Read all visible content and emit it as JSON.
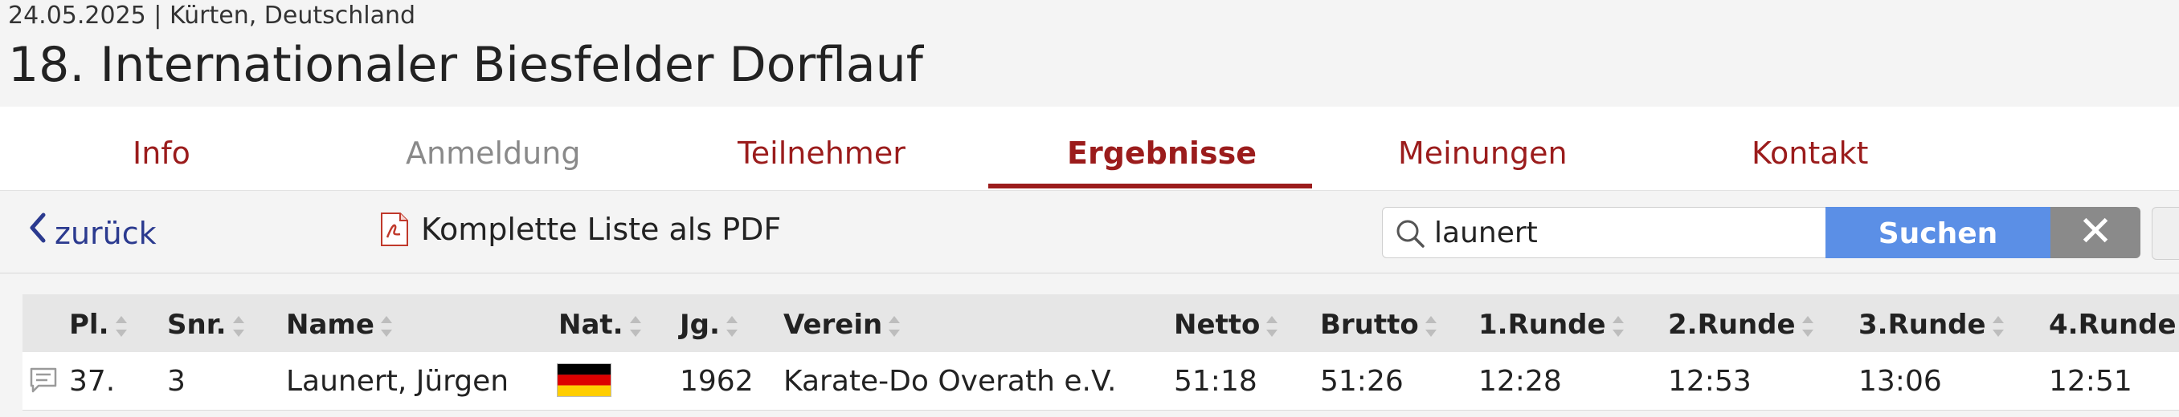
{
  "event": {
    "meta": "24.05.2025 | Kürten, Deutschland",
    "title": "18. Internationaler Biesfelder Dorflauf"
  },
  "tabs": [
    {
      "label": "Info",
      "state": "normal"
    },
    {
      "label": "Anmeldung",
      "state": "disabled"
    },
    {
      "label": "Teilnehmer",
      "state": "normal"
    },
    {
      "label": "Ergebnisse",
      "state": "active"
    },
    {
      "label": "Meinungen",
      "state": "normal"
    },
    {
      "label": "Kontakt",
      "state": "normal"
    }
  ],
  "toolbar": {
    "back_label": "zurück",
    "pdf_label": "Komplette Liste als PDF",
    "search_value": "launert",
    "search_button": "Suchen",
    "clear_button": "✕"
  },
  "table": {
    "headers": [
      "Pl.",
      "Snr.",
      "Name",
      "Nat.",
      "Jg.",
      "Verein",
      "Netto",
      "Brutto",
      "1.Runde",
      "2.Runde",
      "3.Runde",
      "4.Runde"
    ],
    "rows": [
      {
        "pl": "37.",
        "snr": "3",
        "name": "Launert, Jürgen",
        "nat": "germany-flag",
        "jg": "1962",
        "verein": "Karate-Do Overath e.V.",
        "netto": "51:18",
        "brutto": "51:26",
        "r1": "12:28",
        "r2": "12:53",
        "r3": "13:06",
        "r4": "12:51"
      }
    ]
  },
  "colors": {
    "accent": "#9b1c1c",
    "link": "#2b3a8f",
    "search_button": "#5b8fe6",
    "clear_button": "#8a8a8a"
  }
}
